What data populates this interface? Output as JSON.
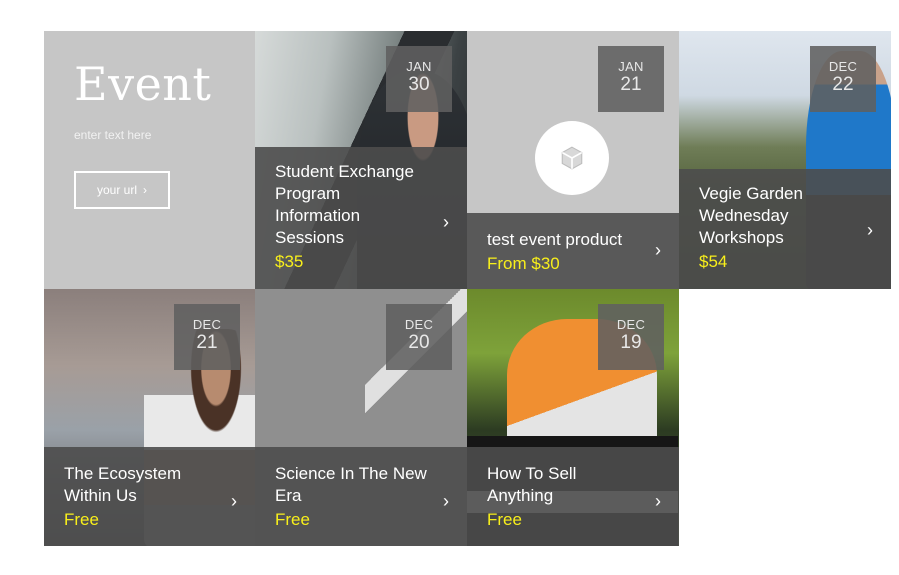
{
  "intro": {
    "title": "Event",
    "subtitle": "enter text here",
    "button_label": "your url",
    "button_chevron": "›"
  },
  "events": [
    {
      "month": "JAN",
      "day": "30",
      "title": "Student Exchange Program Information Sessions",
      "price": "$35",
      "image": "office-man-photo"
    },
    {
      "month": "JAN",
      "day": "21",
      "title": "test event product",
      "price": "From $30",
      "image": "cube-placeholder-icon"
    },
    {
      "month": "DEC",
      "day": "22",
      "title": "Vegie Garden Wednesday Workshops",
      "price": "$54",
      "image": "hiker-photo"
    },
    {
      "month": "DEC",
      "day": "21",
      "title": "The Ecosystem Within Us",
      "price": "Free",
      "image": "street-woman-photo"
    },
    {
      "month": "DEC",
      "day": "20",
      "title": "Science In The New Era",
      "price": "Free",
      "image": "grey-placeholder"
    },
    {
      "month": "DEC",
      "day": "19",
      "title": "How To Sell Anything",
      "price": "Free",
      "image": "soccer-photo"
    }
  ],
  "chevron": "›",
  "colors": {
    "price_accent": "#f8ef1b",
    "tile_grey": "#c6c6c6",
    "caption_band": "#4c4c4c"
  }
}
